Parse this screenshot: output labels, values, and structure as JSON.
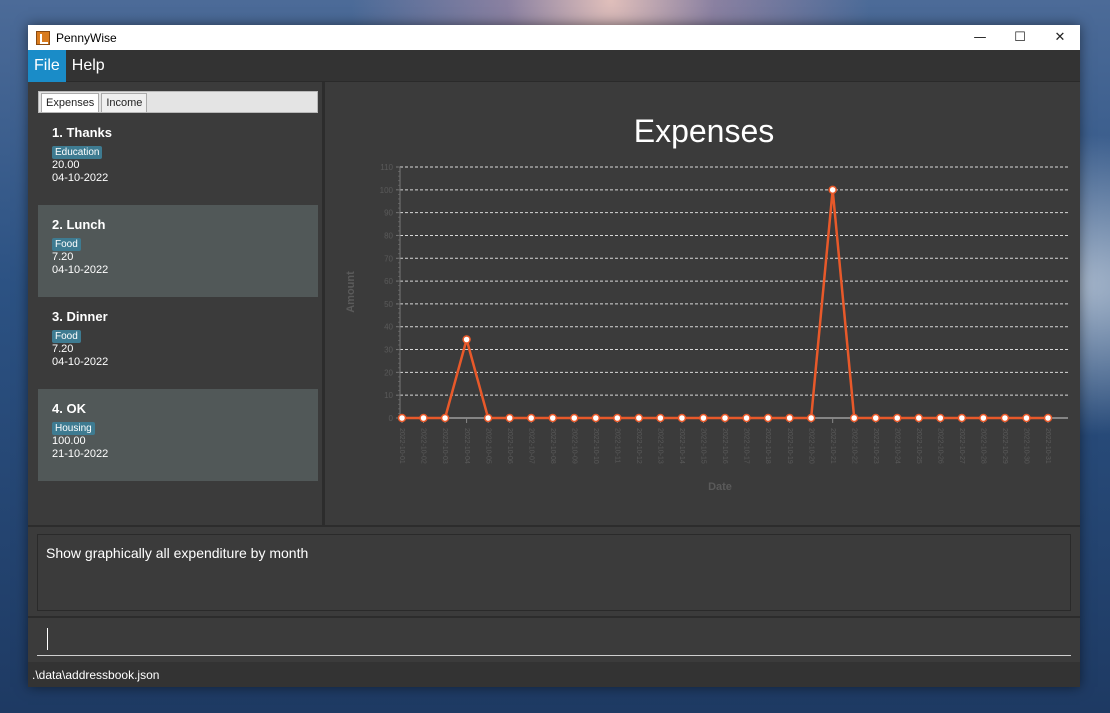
{
  "window": {
    "title": "PennyWise",
    "controls": {
      "minimize": "—",
      "maximize": "☐",
      "close": "✕"
    }
  },
  "menu": [
    {
      "label": "File",
      "active": true
    },
    {
      "label": "Help",
      "active": false
    }
  ],
  "tabs": [
    {
      "label": "Expenses",
      "selected": true
    },
    {
      "label": "Income",
      "selected": false
    }
  ],
  "entries": [
    {
      "title": "1.  Thanks",
      "tag": "Education",
      "amount": "20.00",
      "date": "04-10-2022"
    },
    {
      "title": "2.  Lunch",
      "tag": "Food",
      "amount": "7.20",
      "date": "04-10-2022"
    },
    {
      "title": "3.  Dinner",
      "tag": "Food",
      "amount": "7.20",
      "date": "04-10-2022"
    },
    {
      "title": "4.  OK",
      "tag": "Housing",
      "amount": "100.00",
      "date": "21-10-2022"
    }
  ],
  "result_text": "Show graphically all expenditure by month",
  "command_input": {
    "value": "",
    "placeholder": ""
  },
  "status_path": ".\\data\\addressbook.json",
  "colors": {
    "accent": "#1a8cc8",
    "line": "#e8592a",
    "tag": "#3e7b91"
  },
  "chart_data": {
    "type": "line",
    "title": "Expenses",
    "xlabel": "Date",
    "ylabel": "Amount",
    "ylim": [
      0,
      110
    ],
    "yticks": [
      0,
      10,
      20,
      30,
      40,
      50,
      60,
      70,
      80,
      90,
      100,
      110
    ],
    "grid": true,
    "categories": [
      "2022-10-01",
      "2022-10-02",
      "2022-10-03",
      "2022-10-04",
      "2022-10-05",
      "2022-10-06",
      "2022-10-07",
      "2022-10-08",
      "2022-10-09",
      "2022-10-10",
      "2022-10-11",
      "2022-10-12",
      "2022-10-13",
      "2022-10-14",
      "2022-10-15",
      "2022-10-16",
      "2022-10-17",
      "2022-10-18",
      "2022-10-19",
      "2022-10-20",
      "2022-10-21",
      "2022-10-22",
      "2022-10-23",
      "2022-10-24",
      "2022-10-25",
      "2022-10-26",
      "2022-10-27",
      "2022-10-28",
      "2022-10-29",
      "2022-10-30",
      "2022-10-31"
    ],
    "series": [
      {
        "values": [
          0,
          0,
          0,
          34.4,
          0,
          0,
          0,
          0,
          0,
          0,
          0,
          0,
          0,
          0,
          0,
          0,
          0,
          0,
          0,
          0,
          100,
          0,
          0,
          0,
          0,
          0,
          0,
          0,
          0,
          0,
          0
        ]
      }
    ]
  }
}
